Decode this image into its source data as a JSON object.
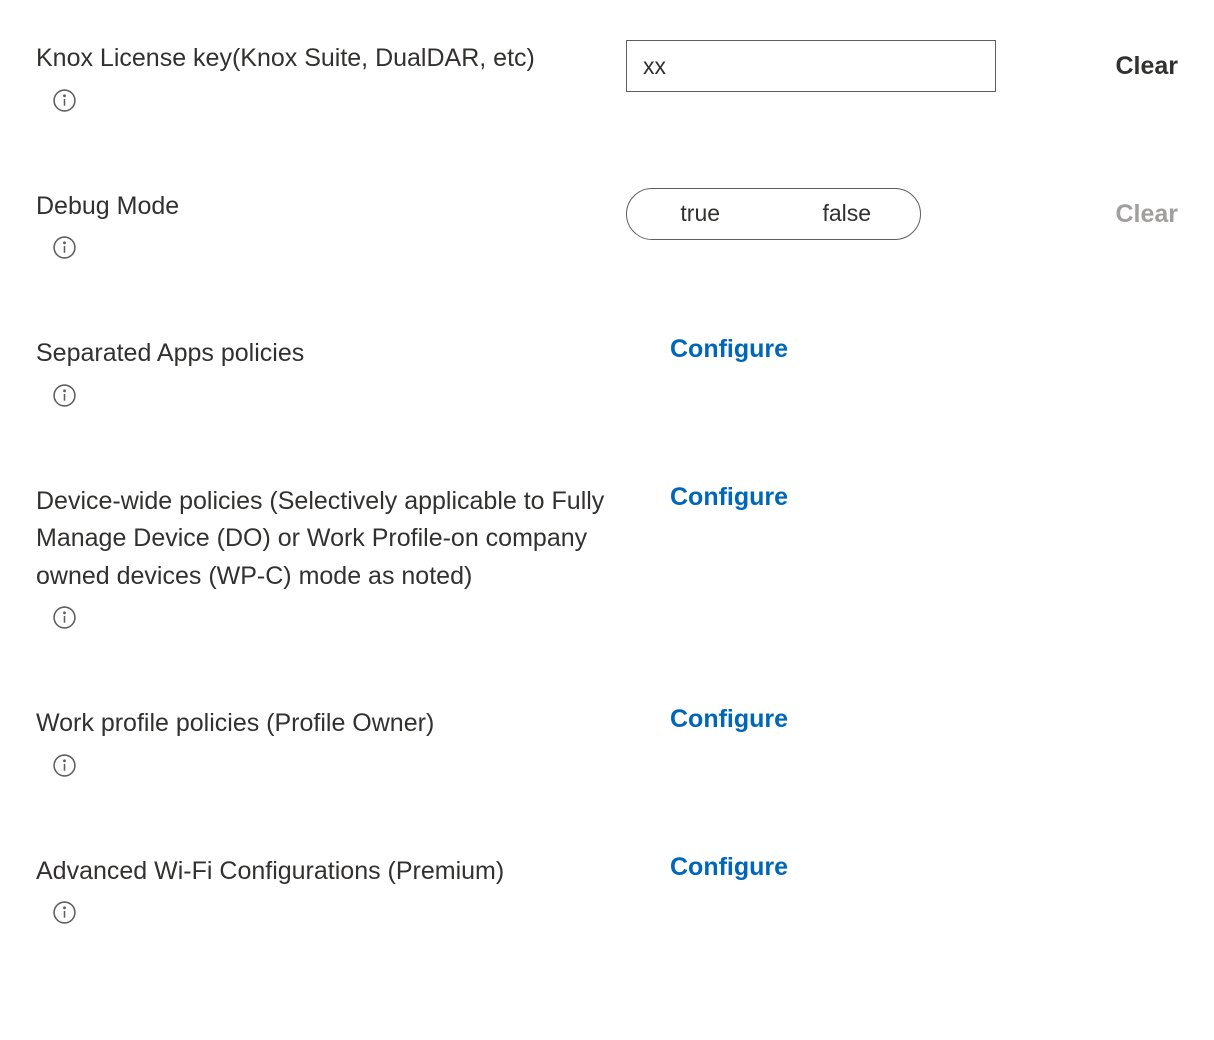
{
  "settings": [
    {
      "label": "Knox License key(Knox Suite, DualDAR, etc)",
      "type": "text",
      "value": "xx",
      "clear_label": "Clear",
      "clear_enabled": true
    },
    {
      "label": "Debug Mode",
      "type": "toggle",
      "option_true": "true",
      "option_false": "false",
      "clear_label": "Clear",
      "clear_enabled": false
    },
    {
      "label": "Separated Apps policies",
      "type": "configure",
      "action_label": "Configure"
    },
    {
      "label": "Device-wide policies (Selectively applicable to Fully Manage Device (DO) or Work Profile-on company owned devices (WP-C) mode as noted)",
      "type": "configure",
      "action_label": "Configure"
    },
    {
      "label": "Work profile policies (Profile Owner)",
      "type": "configure",
      "action_label": "Configure"
    },
    {
      "label": "Advanced Wi-Fi Configurations (Premium)",
      "type": "configure",
      "action_label": "Configure"
    }
  ]
}
